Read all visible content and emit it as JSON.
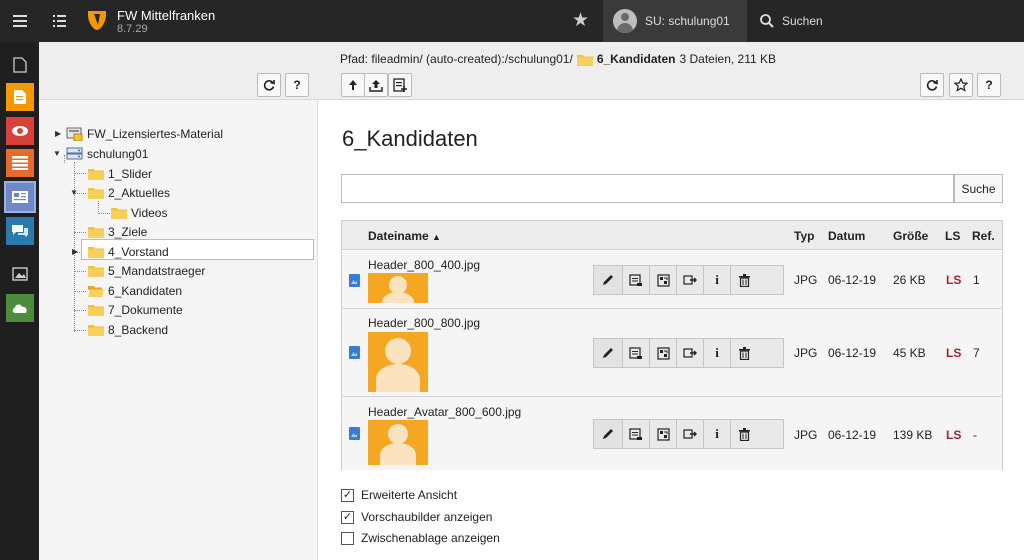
{
  "app": {
    "site_name": "FW Mittelfranken",
    "version": "8.7.29",
    "user": "SU: schulung01",
    "search_label": "Suchen"
  },
  "tree": {
    "items": [
      {
        "label": "FW_Lizensiertes-Material",
        "icon": "mount-icon"
      },
      {
        "label": "schulung01",
        "icon": "storage-icon"
      },
      {
        "label": "1_Slider",
        "icon": "folder-icon"
      },
      {
        "label": "2_Aktuelles",
        "icon": "folder-icon"
      },
      {
        "label": "Videos",
        "icon": "folder-icon"
      },
      {
        "label": "3_Ziele",
        "icon": "folder-icon"
      },
      {
        "label": "4_Vorstand",
        "icon": "folder-icon"
      },
      {
        "label": "5_Mandatstraeger",
        "icon": "folder-icon"
      },
      {
        "label": "6_Kandidaten",
        "icon": "folder-icon"
      },
      {
        "label": "7_Dokumente",
        "icon": "folder-icon"
      },
      {
        "label": "8_Backend",
        "icon": "folder-icon"
      }
    ],
    "refresh_label": "⟳",
    "help_label": "?"
  },
  "path": {
    "prefix": "Pfad: fileadmin/ (auto-created):/schulung01/",
    "current": "6_Kandidaten",
    "info": "3 Dateien, 211 KB"
  },
  "main": {
    "title": "6_Kandidaten",
    "search_placeholder": "",
    "search_button": "Suche",
    "columns": [
      "Dateiname",
      "Typ",
      "Datum",
      "Größe",
      "LS",
      "Ref."
    ],
    "rows": [
      {
        "name": "Header_800_400.jpg",
        "type": "JPG",
        "date": "06-12-19",
        "size": "26 KB",
        "ls": "LS",
        "ref": "1"
      },
      {
        "name": "Header_800_800.jpg",
        "type": "JPG",
        "date": "06-12-19",
        "size": "45 KB",
        "ls": "LS",
        "ref": "7"
      },
      {
        "name": "Header_Avatar_800_600.jpg",
        "type": "JPG",
        "date": "06-12-19",
        "size": "139 KB",
        "ls": "LS",
        "ref": "-"
      }
    ],
    "action_icons": [
      "pencil-icon",
      "metadata-icon",
      "replace-icon",
      "move-icon",
      "info-icon",
      "trash-icon"
    ],
    "info_glyph": "i"
  },
  "options": [
    {
      "label": "Erweiterte Ansicht",
      "checked": true
    },
    {
      "label": "Vorschaubilder anzeigen",
      "checked": true
    },
    {
      "label": "Zwischenablage anzeigen",
      "checked": false
    }
  ],
  "colors": {
    "topbar": "#262626",
    "modbar": "#1f1f1f",
    "accent_orange": "#f49700",
    "ls_red": "#a4262c",
    "folder": "#f4c13a"
  }
}
